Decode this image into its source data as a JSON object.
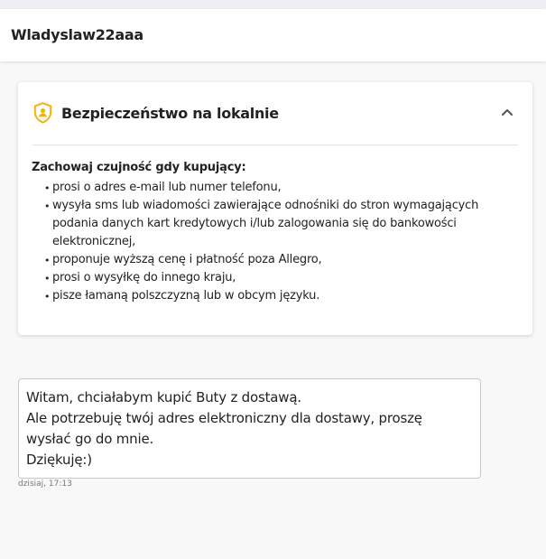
{
  "header": {
    "username": "Wladyslaw22aaa"
  },
  "safety_panel": {
    "title": "Bezpieczeństwo na lokalnie",
    "icon": "shield-user-icon",
    "icon_color": "#f5b400",
    "expanded": true,
    "heading": "Zachowaj czujność gdy kupujący:",
    "items": [
      "prosi o adres e-mail lub numer telefonu,",
      "wysyła sms lub wiadomości zawierające odnośniki do stron wymagających podania danych kart kredytowych i/lub zalogowania się do bankowości elektronicznej,",
      "proponuje wyższą cenę i płatność poza Allegro,",
      "prosi o wysyłkę do innego kraju,",
      "pisze łamaną polszczyzną lub w obcym języku."
    ]
  },
  "conversation": {
    "messages": [
      {
        "lines": [
          "Witam, chciałabym kupić Buty z dostawą.",
          "Ale potrzebuję twój adres elektroniczny dla dostawy, proszę",
          "wysłać go do mnie.",
          "Dziękuję:)"
        ],
        "time": "dzisiaj, 17:13"
      }
    ]
  }
}
